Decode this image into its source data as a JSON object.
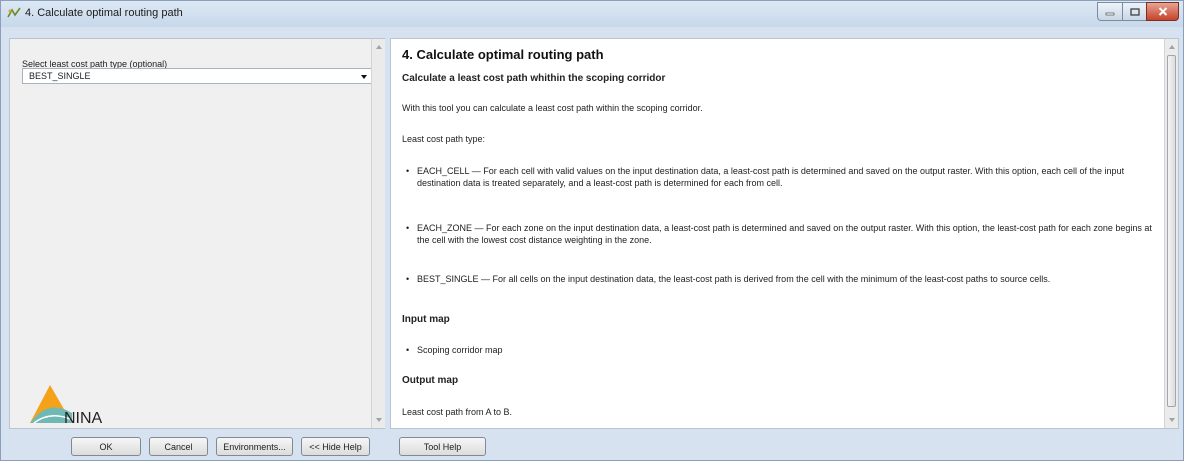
{
  "window": {
    "title": "4. Calculate optimal routing path",
    "controls": {
      "minimize_icon": "minimize-icon",
      "maximize_icon": "maximize-icon",
      "close_icon": "close-icon"
    }
  },
  "params": {
    "label": "Select least cost path type (optional)",
    "value": "BEST_SINGLE"
  },
  "logo": {
    "text": "NINA"
  },
  "help": {
    "title": "4. Calculate optimal routing path",
    "subtitle": "Calculate a least cost path whithin the scoping corridor",
    "intro": "With this tool you can calculate a least cost path within the scoping corridor.",
    "type_heading": "Least cost path type:",
    "types": [
      "EACH_CELL — For each cell with valid values on the input destination data, a least-cost path is determined and saved on the output raster. With this option, each cell of the input destination data is treated separately, and a least-cost path is determined for each from cell.",
      "EACH_ZONE — For each zone on the input destination data, a least-cost path is determined and saved on the output raster. With this option, the least-cost path for each zone begins at the cell with the lowest cost distance weighting in the zone.",
      "BEST_SINGLE — For all cells on the input destination data, the least-cost path is derived from the cell with the minimum of the least-cost paths to source cells."
    ],
    "input_heading": "Input map",
    "input_items": [
      "Scoping corridor map"
    ],
    "output_heading": "Output map",
    "output_text": "Least cost path from A to B."
  },
  "buttons": {
    "ok": "OK",
    "cancel": "Cancel",
    "environments": "Environments...",
    "hide_help": "<< Hide Help",
    "tool_help": "Tool Help"
  },
  "colors": {
    "window_frame": "#d6e2ef",
    "close_button": "#c5432b",
    "logo_orange": "#f5a21b",
    "logo_teal": "#6fb8b3"
  }
}
